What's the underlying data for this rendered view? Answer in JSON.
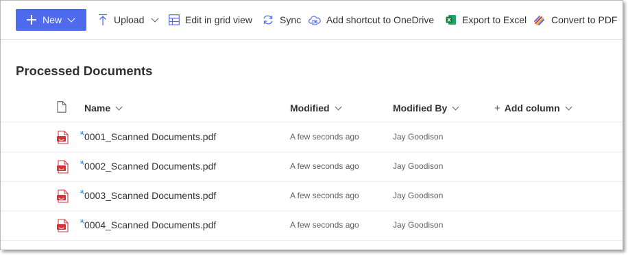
{
  "toolbar": {
    "new_label": "New",
    "upload_label": "Upload",
    "grid_label": "Edit in grid view",
    "sync_label": "Sync",
    "shortcut_label": "Add shortcut to OneDrive",
    "excel_label": "Export to Excel",
    "pdf_label": "Convert to PDF"
  },
  "page": {
    "title": "Processed Documents"
  },
  "columns": {
    "name": "Name",
    "modified": "Modified",
    "modified_by": "Modified By",
    "add_column": "Add column"
  },
  "files": [
    {
      "name": "0001_Scanned Documents.pdf",
      "modified": "A few seconds ago",
      "modified_by": "Jay Goodison"
    },
    {
      "name": "0002_Scanned Documents.pdf",
      "modified": "A few seconds ago",
      "modified_by": "Jay Goodison"
    },
    {
      "name": "0003_Scanned Documents.pdf",
      "modified": "A few seconds ago",
      "modified_by": "Jay Goodison"
    },
    {
      "name": "0004_Scanned Documents.pdf",
      "modified": "A few seconds ago",
      "modified_by": "Jay Goodison"
    }
  ],
  "icons": {
    "new": "plus-icon",
    "upload": "upload-arrow-icon",
    "grid": "grid-icon",
    "sync": "sync-icon",
    "shortcut": "cloud-shortcut-icon",
    "excel": "excel-icon",
    "pdf": "pdf-convert-icon",
    "file_type": "document-icon",
    "pdf_file": "pdf-file-icon",
    "new_item": "new-item-sparkle-icon"
  },
  "colors": {
    "accent": "#4f6bed",
    "pdf_red": "#d13438",
    "excel_green": "#107c41",
    "new_item_blue": "#2b88d8"
  }
}
